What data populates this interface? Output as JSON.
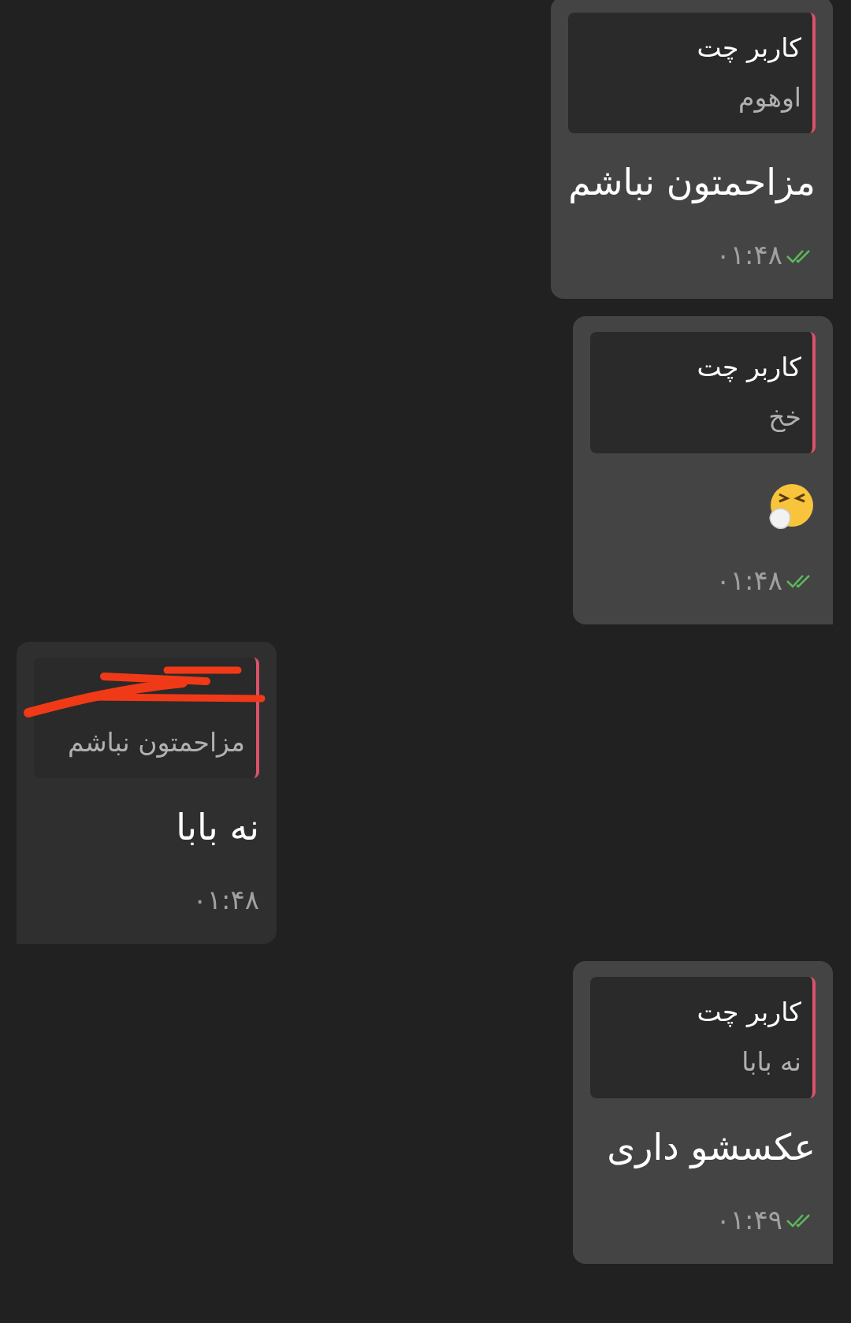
{
  "messages": [
    {
      "kind": "outgoing",
      "reply": {
        "redacted": false,
        "author": "کاربر چت",
        "text": "اوهوم"
      },
      "body": {
        "kind": "text",
        "text": "مزاحمتون نباشم"
      },
      "time": "۰۱:۴۸",
      "read": true
    },
    {
      "kind": "outgoing",
      "reply": {
        "redacted": false,
        "author": "کاربر چت",
        "text": "خخ"
      },
      "body": {
        "kind": "emoji"
      },
      "time": "۰۱:۴۸",
      "read": true
    },
    {
      "kind": "incoming",
      "reply": {
        "redacted": true,
        "text": "مزاحمتون نباشم"
      },
      "body": {
        "kind": "text",
        "text": "نه بابا"
      },
      "time": "۰۱:۴۸"
    },
    {
      "kind": "outgoing",
      "reply": {
        "redacted": false,
        "author": "کاربر چت",
        "text": "نه بابا"
      },
      "body": {
        "kind": "text",
        "text": "عکسشو داری"
      },
      "time": "۰۱:۴۹",
      "read": true
    }
  ]
}
